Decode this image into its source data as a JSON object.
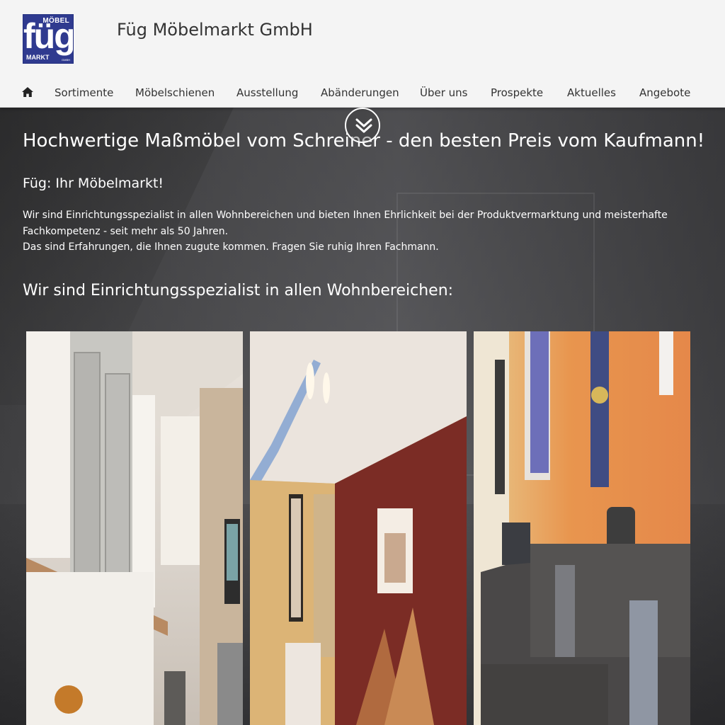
{
  "logo": {
    "top": "MÖBEL",
    "main": "füg",
    "bottom": "MARKT",
    "gmbh": "GMBH"
  },
  "brand": "Füg Möbelmarkt GmbH",
  "nav": {
    "home_icon": "home-icon",
    "items": [
      "Sortimente",
      "Möbelschienen",
      "Ausstellung",
      "Abänderungen",
      "Über uns",
      "Prospekte",
      "Aktuelles",
      "Angebote"
    ]
  },
  "hero": {
    "scroll_icon": "double-chevron-down-icon",
    "headline": "Hochwertige Maßmöbel vom Schreiner - den besten Preis vom Kaufmann!",
    "subheadline": "Füg: Ihr Möbelmarkt!",
    "para_line1": "Wir sind Einrichtungsspezialist in allen Wohnbereichen und bieten Ihnen Ehrlichkeit bei der Produktvermarktung und meisterhafte",
    "para_line2": "Fachkompetenz - seit mehr als 50 Jahren.",
    "para_line3": "Das sind Erfahrungen, die Ihnen zugute kommen. Fragen Sie ruhig Ihren Fachmann.",
    "section_title": "Wir sind Einrichtungsspezialist in allen Wohnbereichen:"
  },
  "colors": {
    "logo_blue": "#2f3a8f",
    "header_bg": "#f4f4f4",
    "text_dark": "#333333"
  }
}
